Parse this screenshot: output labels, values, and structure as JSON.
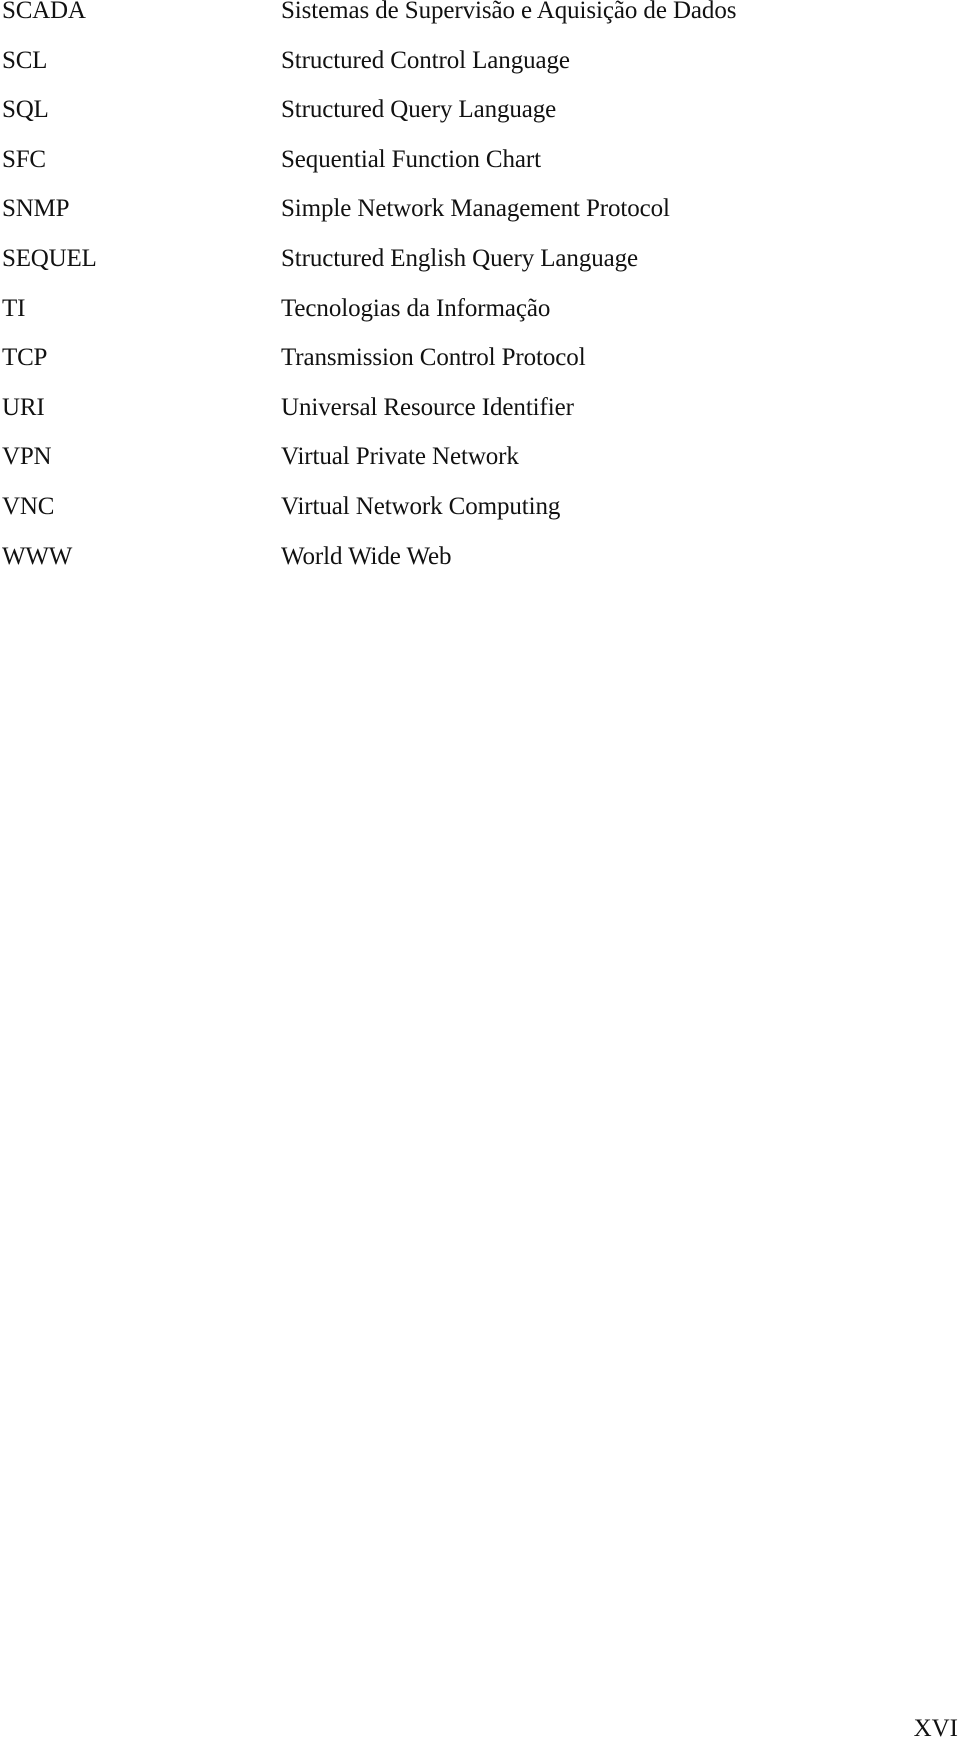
{
  "abbreviations": [
    {
      "term": "SCADA",
      "definition": "Sistemas de Supervisão e Aquisição de Dados"
    },
    {
      "term": "SCL",
      "definition": "Structured Control Language"
    },
    {
      "term": "SQL",
      "definition": "Structured Query Language"
    },
    {
      "term": "SFC",
      "definition": "Sequential Function Chart"
    },
    {
      "term": "SNMP",
      "definition": "Simple Network Management Protocol"
    },
    {
      "term": "SEQUEL",
      "definition": "Structured English Query Language"
    },
    {
      "term": "TI",
      "definition": "Tecnologias da Informação"
    },
    {
      "term": "TCP",
      "definition": "Transmission Control Protocol"
    },
    {
      "term": "URI",
      "definition": "Universal Resource Identifier"
    },
    {
      "term": "VPN",
      "definition": "Virtual Private Network"
    },
    {
      "term": "VNC",
      "definition": "Virtual Network Computing"
    },
    {
      "term": "WWW",
      "definition": "World Wide Web"
    }
  ],
  "page_number": "XVI"
}
